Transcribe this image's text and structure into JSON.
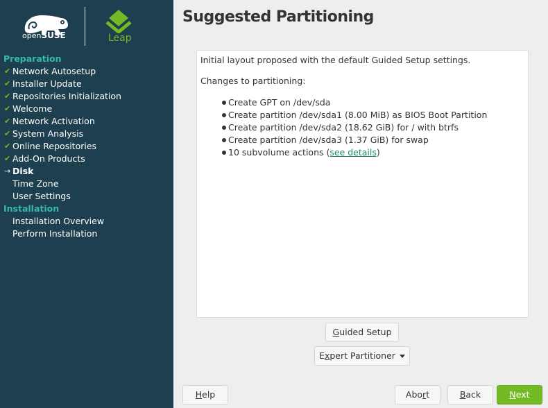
{
  "branding": {
    "distro_prefix": "open",
    "distro_name": "SUSE",
    "edition": "Leap",
    "brand_green": "#73ba25",
    "sidebar_bg": "#1d3f4f",
    "section_color": "#35b9ab"
  },
  "sidebar": {
    "sections": [
      {
        "label": "Preparation",
        "items": [
          {
            "label": "Network Autosetup",
            "status": "done"
          },
          {
            "label": "Installer Update",
            "status": "done"
          },
          {
            "label": "Repositories Initialization",
            "status": "done"
          },
          {
            "label": "Welcome",
            "status": "done"
          },
          {
            "label": "Network Activation",
            "status": "done"
          },
          {
            "label": "System Analysis",
            "status": "done"
          },
          {
            "label": "Online Repositories",
            "status": "done"
          },
          {
            "label": "Add-On Products",
            "status": "done"
          },
          {
            "label": "Disk",
            "status": "current"
          },
          {
            "label": "Time Zone",
            "status": "pending"
          },
          {
            "label": "User Settings",
            "status": "pending"
          }
        ]
      },
      {
        "label": "Installation",
        "items": [
          {
            "label": "Installation Overview",
            "status": "pending"
          },
          {
            "label": "Perform Installation",
            "status": "pending"
          }
        ]
      }
    ]
  },
  "main": {
    "title": "Suggested Partitioning",
    "intro": "Initial layout proposed with the default Guided Setup settings.",
    "changes_label": "Changes to partitioning:",
    "changes": [
      "Create GPT on /dev/sda",
      "Create partition /dev/sda1 (8.00 MiB) as BIOS Boot Partition",
      "Create partition /dev/sda2 (18.62 GiB) for / with btrfs",
      "Create partition /dev/sda3 (1.37 GiB) for swap"
    ],
    "subvolume_prefix": "10 subvolume actions (",
    "subvolume_link": "see details",
    "subvolume_suffix": ")",
    "guided_setup": {
      "accel": "G",
      "rest": "uided Setup"
    },
    "expert_partitioner": {
      "pre": "E",
      "accel": "x",
      "rest": "pert Partitioner"
    }
  },
  "footer": {
    "help": {
      "accel": "H",
      "rest": "elp"
    },
    "abort": {
      "pre": "Abo",
      "accel": "r",
      "rest": "t"
    },
    "back": {
      "accel": "B",
      "rest": "ack"
    },
    "next": {
      "accel": "N",
      "rest": "ext"
    }
  }
}
